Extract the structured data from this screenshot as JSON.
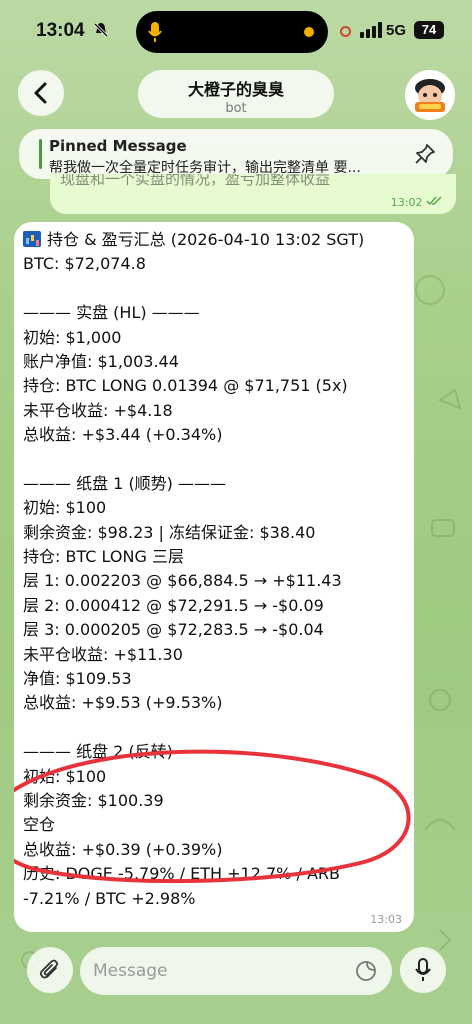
{
  "status_bar": {
    "time": "13:04",
    "network": "5G",
    "battery": "74"
  },
  "header": {
    "title": "大橙子的臭臭",
    "subtitle": "bot"
  },
  "pinned": {
    "label": "Pinned Message",
    "text": "帮我做一次全量定时任务审计，输出完整清单 要..."
  },
  "previous_message": {
    "fragment": "现盘和一个实盘的情况，盈亏加整体收益",
    "time": "13:02"
  },
  "message": {
    "lines": [
      "持仓 & 盈亏汇总 (2026-04-10 13:02 SGT)",
      "BTC: $72,074.8",
      "",
      "——— 实盘 (HL) ———",
      "初始: $1,000",
      "账户净值: $1,003.44",
      "持仓: BTC LONG 0.01394 @ $71,751 (5x)",
      "未平仓收益: +$4.18",
      "总收益: +$3.44 (+0.34%)",
      "",
      "——— 纸盘 1 (顺势) ———",
      "初始: $100",
      "剩余资金: $98.23 | 冻结保证金: $38.40",
      "持仓: BTC LONG 三层",
      "层 1: 0.002203 @ $66,884.5 → +$11.43",
      "层 2: 0.000412 @ $72,291.5 → -$0.09",
      "层 3: 0.000205 @ $72,283.5 → -$0.04",
      "未平仓收益: +$11.30",
      "净值: $109.53",
      "总收益: +$9.53 (+9.53%)",
      "",
      "——— 纸盘 2 (反转) ———",
      "初始: $100",
      "剩余资金: $100.39",
      "空仓",
      "总收益: +$0.39 (+0.39%)",
      "历史: DOGE -5.79% / ETH +12.7% / ARB",
      "-7.21% / BTC +2.98%"
    ],
    "time": "13:03"
  },
  "input": {
    "placeholder": "Message"
  },
  "colors": {
    "accent_green": "#4a9a3c",
    "outgoing_bubble": "#e6fbd0",
    "highlight_stroke": "#e8333a"
  }
}
